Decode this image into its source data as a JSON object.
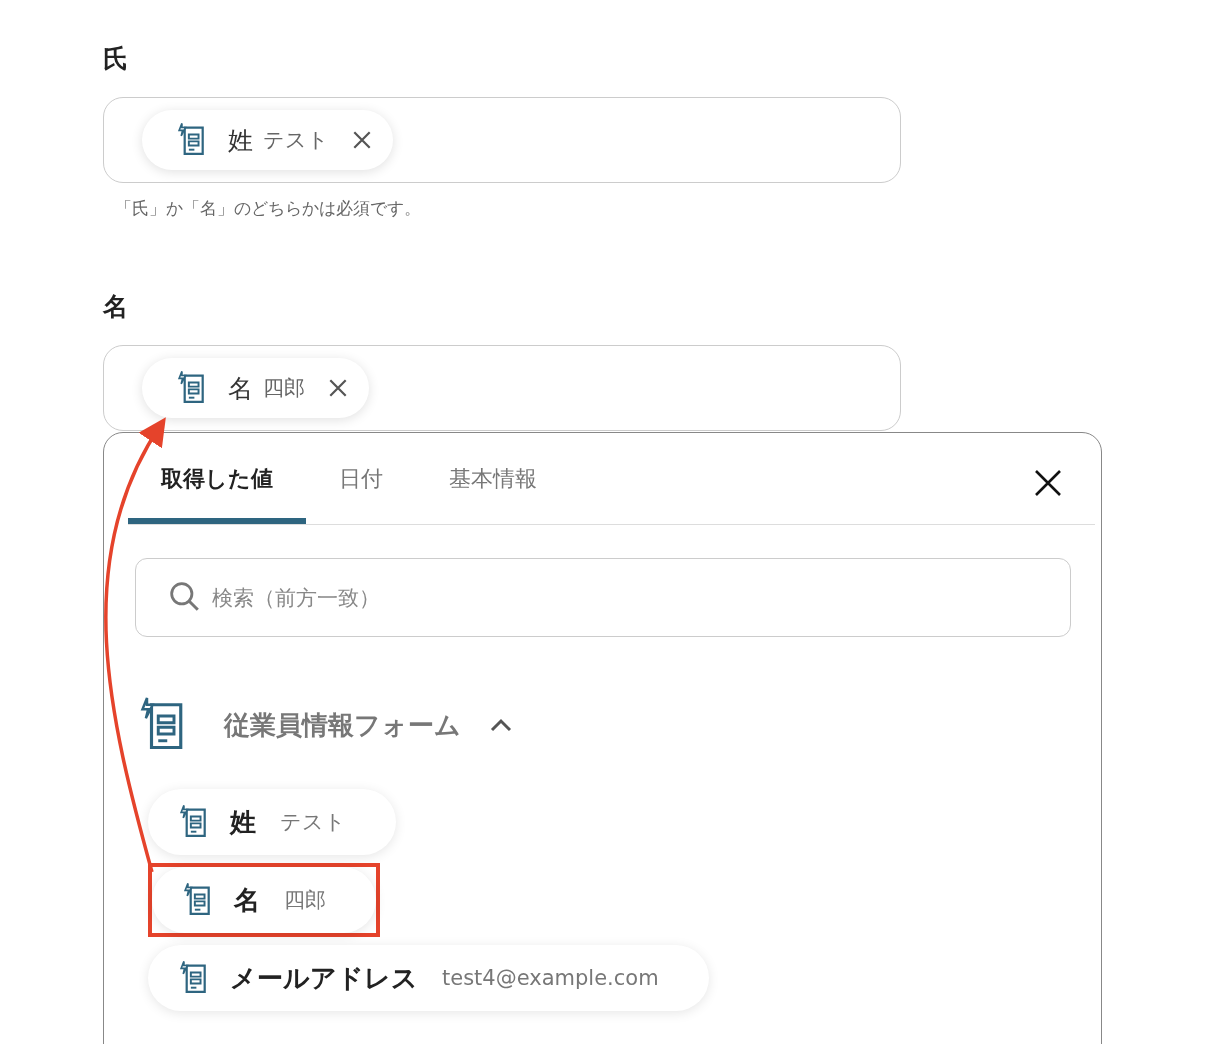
{
  "fields": [
    {
      "label": "氏",
      "chips": [
        {
          "name": "姓",
          "value": "テスト"
        }
      ],
      "hint": "「氏」か「名」のどちらかは必須です。"
    },
    {
      "label": "名",
      "chips": [
        {
          "name": "名",
          "value": "四郎"
        }
      ]
    }
  ],
  "picker": {
    "tabs": [
      {
        "label": "取得した値",
        "selected": true
      },
      {
        "label": "日付",
        "selected": false
      },
      {
        "label": "基本情報",
        "selected": false
      }
    ],
    "search": {
      "placeholder": "検索（前方一致）"
    },
    "group": {
      "title": "従業員情報フォーム",
      "expanded": true,
      "items": [
        {
          "name": "姓",
          "value": "テスト",
          "highlighted": false
        },
        {
          "name": "名",
          "value": "四郎",
          "highlighted": true
        },
        {
          "name": "メールアドレス",
          "value": "test4@example.com",
          "highlighted": false
        }
      ]
    }
  }
}
